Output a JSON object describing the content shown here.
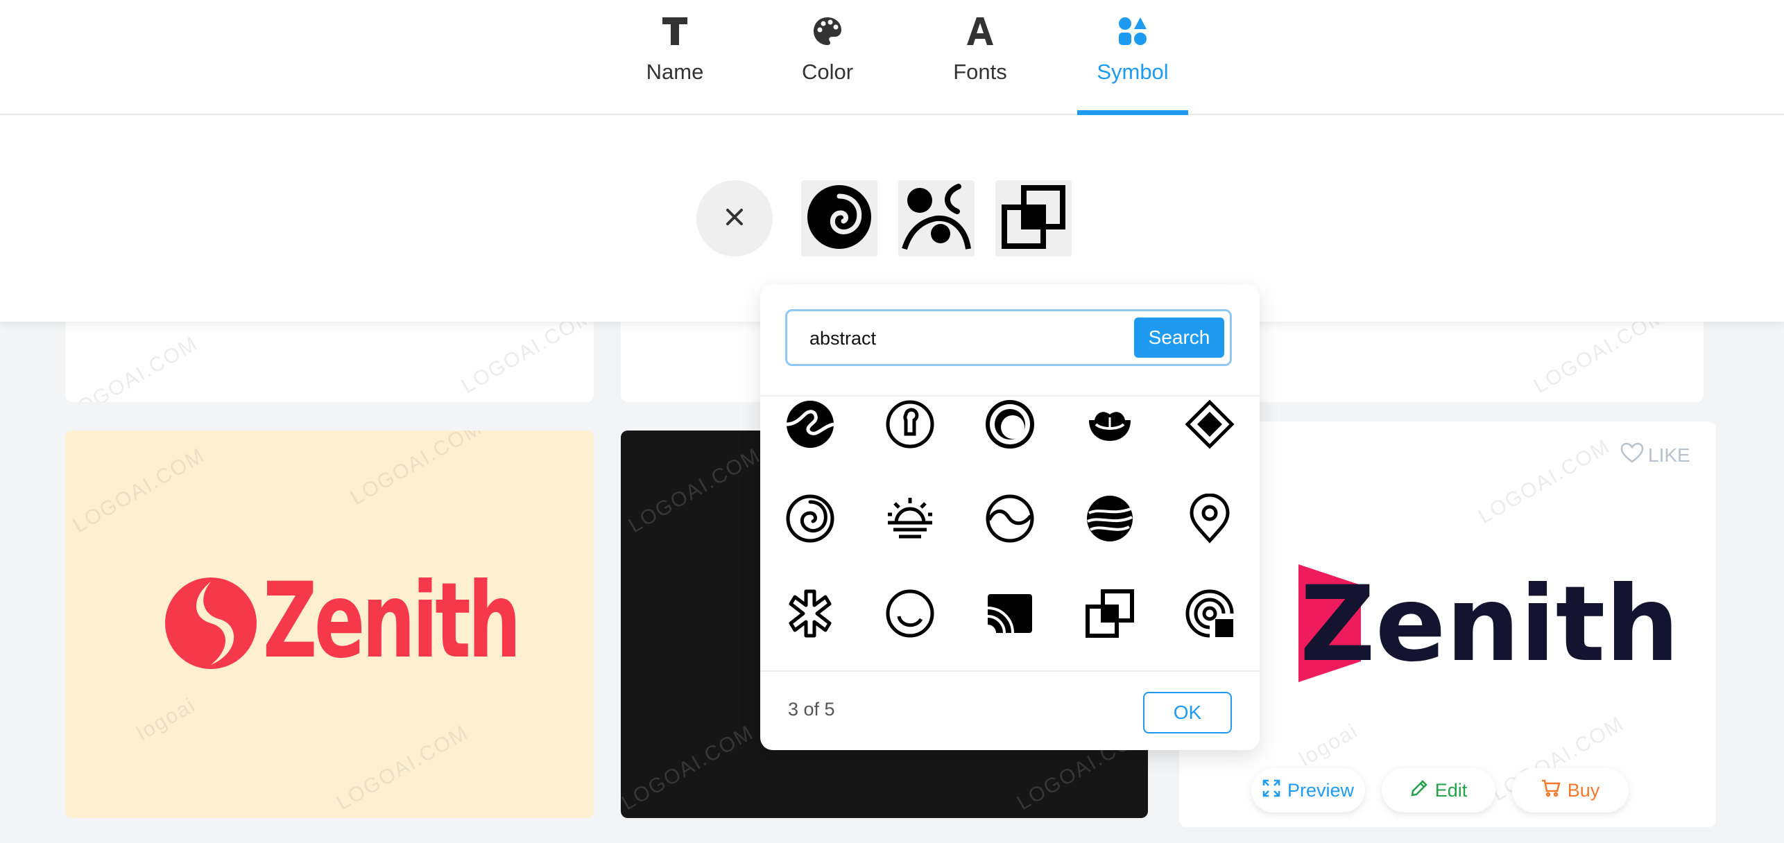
{
  "tabs": [
    {
      "label": "Name",
      "icon": "text-t-icon"
    },
    {
      "label": "Color",
      "icon": "palette-icon"
    },
    {
      "label": "Fonts",
      "icon": "font-a-icon"
    },
    {
      "label": "Symbol",
      "icon": "shapes-icon",
      "active": true
    }
  ],
  "selected_symbols": [
    "spiral-symbol",
    "abstract-figure-symbol",
    "overlapping-squares-symbol"
  ],
  "watermark": {
    "text": "LOGOAI.COM",
    "brand": "logoai"
  },
  "popup": {
    "search_value": "abstract",
    "search_button": "Search",
    "pager": "3 of 5",
    "ok_label": "OK",
    "symbols": [
      "swirl-circle-icon",
      "keyhole-icon",
      "crescent-ring-icon",
      "lotus-bowl-icon",
      "diamond-icon",
      "spiral-icon",
      "sunrise-icon",
      "wave-circle-icon",
      "striped-globe-icon",
      "location-pin-icon",
      "asterisk-icon",
      "open-circle-icon",
      "cast-icon",
      "layered-squares-icon",
      "radar-square-icon"
    ]
  },
  "cards": {
    "left_logo": "Zenith",
    "right_logo": "Zenith",
    "like_label": "LIKE",
    "preview_label": "Preview",
    "edit_label": "Edit",
    "buy_label": "Buy"
  },
  "colors": {
    "accent": "#1e9bf0",
    "zenith_red": "#f5394b",
    "zenith_navy": "#141430",
    "zenith_pink": "#ee1c5c",
    "edit_green": "#22a34a",
    "buy_orange": "#f5782a",
    "card_cream": "#fdefcf"
  }
}
